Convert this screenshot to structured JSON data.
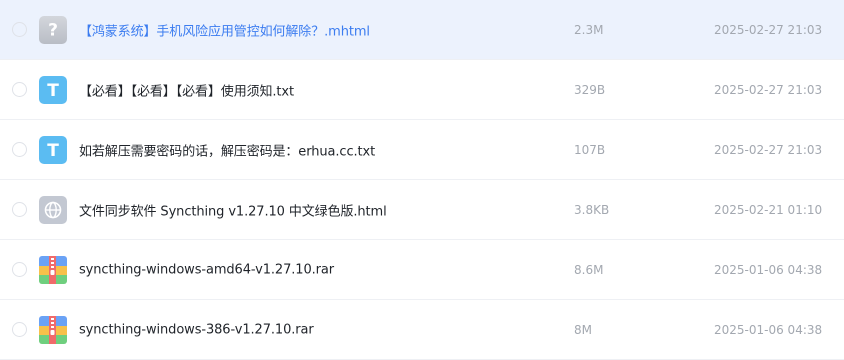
{
  "files": [
    {
      "name": "【鸿蒙系统】手机风险应用管控如何解除？.mhtml",
      "size": "2.3M",
      "modified": "2025-02-27 21:03",
      "icon": "unknown-file-icon",
      "selected": true
    },
    {
      "name": "【必看】【必看】【必看】使用须知.txt",
      "size": "329B",
      "modified": "2025-02-27 21:03",
      "icon": "text-file-icon",
      "selected": false
    },
    {
      "name": "如若解压需要密码的话，解压密码是：erhua.cc.txt",
      "size": "107B",
      "modified": "2025-02-27 21:03",
      "icon": "text-file-icon",
      "selected": false
    },
    {
      "name": "文件同步软件 Syncthing v1.27.10 中文绿色版.html",
      "size": "3.8KB",
      "modified": "2025-02-21 01:10",
      "icon": "web-file-icon",
      "selected": false
    },
    {
      "name": "syncthing-windows-amd64-v1.27.10.rar",
      "size": "8.6M",
      "modified": "2025-01-06 04:38",
      "icon": "archive-file-icon",
      "selected": false
    },
    {
      "name": "syncthing-windows-386-v1.27.10.rar",
      "size": "8M",
      "modified": "2025-01-06 04:38",
      "icon": "archive-file-icon",
      "selected": false
    }
  ],
  "icon_glyphs": {
    "unknown": "?",
    "text": "T"
  },
  "colors": {
    "selected_row": "#ecf2fd",
    "selected_text": "#3b7cf0",
    "text_icon": "#5bbcf2",
    "unknown_icon": "#c5c9d1",
    "web_icon": "#c3c8d2"
  }
}
